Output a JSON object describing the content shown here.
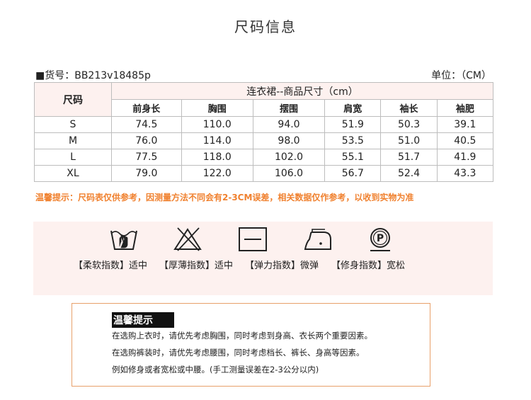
{
  "title": "尺码信息",
  "meta": {
    "item_no": "■货号：BB213v18485p",
    "unit": "单位：（CM）"
  },
  "table": {
    "size_header": "尺码",
    "group_header": "连衣裙--商品尺寸（cm）",
    "columns": [
      "前身长",
      "胸围",
      "摆围",
      "肩宽",
      "袖长",
      "袖肥"
    ],
    "rows": [
      {
        "size": "S",
        "values": [
          "74.5",
          "110.0",
          "94.0",
          "51.9",
          "50.3",
          "39.1"
        ]
      },
      {
        "size": "M",
        "values": [
          "76.0",
          "114.0",
          "98.0",
          "53.5",
          "51.0",
          "40.5"
        ]
      },
      {
        "size": "L",
        "values": [
          "77.5",
          "118.0",
          "102.0",
          "55.1",
          "51.7",
          "41.9"
        ]
      },
      {
        "size": "XL",
        "values": [
          "79.0",
          "122.0",
          "106.0",
          "56.7",
          "52.4",
          "43.3"
        ]
      }
    ]
  },
  "warning": "温馨提示：尺码表仅供参考，因测量方法不同会有2-3CM误差，相关数据仅作参考，以收到实物为准",
  "care": [
    {
      "icon": "hand-wash-icon",
      "label": "【柔软指数】适中"
    },
    {
      "icon": "no-bleach-icon",
      "label": "【厚薄指数】适中"
    },
    {
      "icon": "flat-dry-icon",
      "label": "【弹力指数】微弹"
    },
    {
      "icon": "iron-icon",
      "label": "【修身指数】宽松"
    },
    {
      "icon": "dry-clean-p-icon",
      "label": "P"
    }
  ],
  "tips": {
    "title": "温馨提示",
    "lines": [
      "在选购上衣时，请优先考虑胸围，同时考虑到身高、衣长两个重要因素。",
      "在选购裤装时，请优先考虑腰围，同时考虑档长、裤长、身高等因素。",
      "例如修身或者宽松或中腰。(手工测量误差在2-3公分以内)"
    ]
  },
  "colors": {
    "accent_orange": "#f0812f",
    "panel_pink": "#fdf1ef",
    "tips_border": "#e8a06a"
  }
}
